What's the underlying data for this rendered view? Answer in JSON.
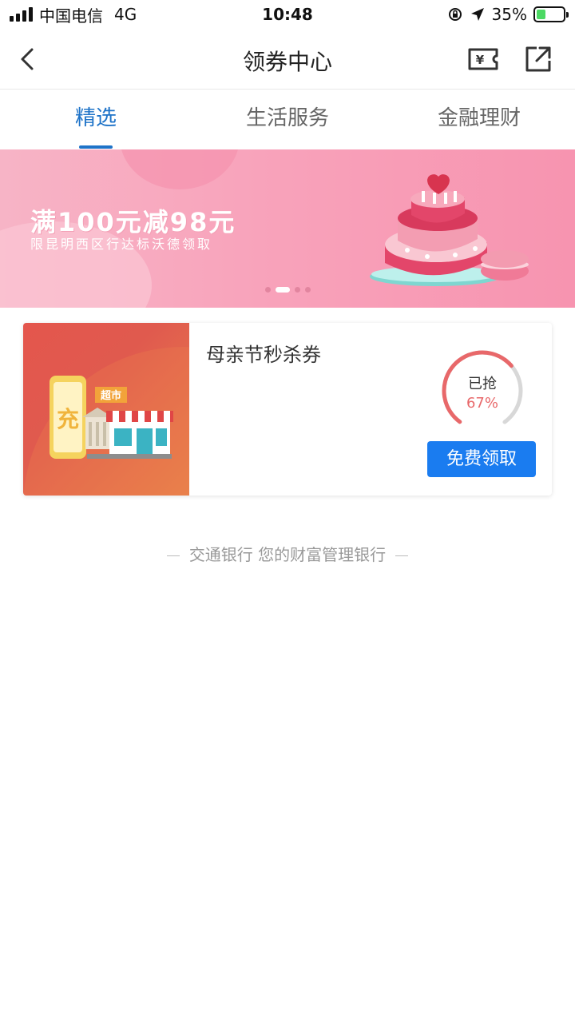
{
  "status_bar": {
    "carrier": "中国电信",
    "network": "4G",
    "time": "10:48",
    "battery_pct": "35%",
    "battery_fill": 0.35
  },
  "nav": {
    "title": "领券中心",
    "back_icon": "chevron-left-icon",
    "coupon_icon": "yen-ticket-icon",
    "share_icon": "share-out-icon",
    "coupon_icon_text": "¥"
  },
  "tabs": [
    {
      "label": "精选",
      "active": true
    },
    {
      "label": "生活服务",
      "active": false
    },
    {
      "label": "金融理财",
      "active": false
    }
  ],
  "banner": {
    "title": "满100元减98元",
    "subtitle": "限昆明西区行达标沃德领取",
    "slide_count": 4,
    "active_slide": 1
  },
  "coupon": {
    "title": "母亲节秒杀券",
    "image_char": "充",
    "image_sign": "超市",
    "progress_label": "已抢",
    "progress_pct": "67%",
    "progress_value": 0.67,
    "button_label": "免费领取"
  },
  "footer": {
    "slogan": "交通银行 您的财富管理银行"
  },
  "colors": {
    "accent": "#1e73c8",
    "button": "#1a7cf0",
    "progress": "#e8686a",
    "banner_pink": "#f8a3bb"
  }
}
